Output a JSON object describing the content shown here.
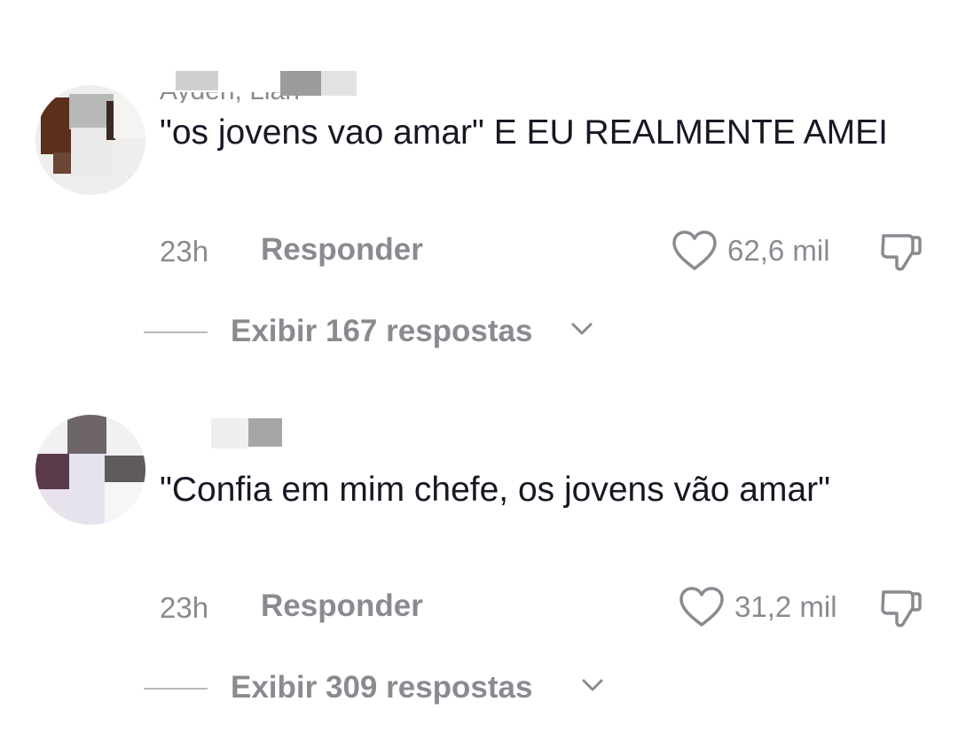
{
  "comments": [
    {
      "username": "Ayden, Lian",
      "text": "\"os jovens vao amar\" E EU REALMENTE AMEI",
      "time": "23h",
      "reply_label": "Responder",
      "likes": "62,6 mil",
      "view_replies": "Exibir 167 respostas"
    },
    {
      "username": "",
      "text": "\"Confia em mim chefe, os jovens vão amar\"",
      "time": "23h",
      "reply_label": "Responder",
      "likes": "31,2 mil",
      "view_replies": "Exibir 309 respostas"
    }
  ],
  "icons": {
    "like": "heart-outline-icon",
    "dislike": "thumbs-down-icon",
    "expand": "chevron-down-icon"
  },
  "colors": {
    "text_primary": "#161823",
    "text_secondary": "#8a8b91",
    "divider": "#b9b9bd"
  }
}
